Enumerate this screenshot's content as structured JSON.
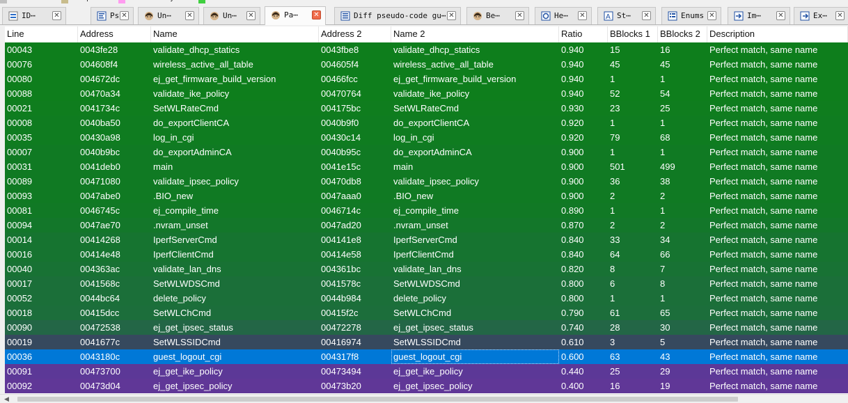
{
  "legend": [
    {
      "label": "ction",
      "color": ""
    },
    {
      "label": "Data",
      "color": "#c0c0c0"
    },
    {
      "label": "Unexplored",
      "color": "#c8bc8c"
    },
    {
      "label": "External symbol",
      "color": "#ff9cf0"
    },
    {
      "label": "Lumina function",
      "color": "#40d040"
    }
  ],
  "tabs": [
    {
      "label": "ID⋯",
      "icon": "ida-view-icon"
    },
    {
      "label": "Ps⋯",
      "icon": "pseudocode-icon"
    },
    {
      "label": "Un⋯",
      "icon": "unmatched-person-icon"
    },
    {
      "label": "Un⋯",
      "icon": "unmatched-person-icon"
    },
    {
      "label": "Pa⋯",
      "icon": "partial-person-icon",
      "active": true
    },
    {
      "label": "Diff pseudo-code gu⋯",
      "icon": "diff-document-icon"
    },
    {
      "label": "Be⋯",
      "icon": "best-person-icon"
    },
    {
      "label": "He⋯",
      "icon": "hex-view-icon"
    },
    {
      "label": "St⋯",
      "icon": "strings-icon"
    },
    {
      "label": "Enums",
      "icon": "enums-icon"
    },
    {
      "label": "Im⋯",
      "icon": "imports-icon"
    },
    {
      "label": "Ex⋯",
      "icon": "exports-icon"
    }
  ],
  "columns": [
    "Line",
    "Address",
    "Name",
    "Address 2",
    "Name 2",
    "Ratio",
    "BBlocks 1",
    "BBlocks 2",
    "Description"
  ],
  "rows": [
    {
      "line": "00043",
      "addr": "0043fe28",
      "name": "validate_dhcp_statics",
      "addr2": "0043fbe8",
      "name2": "validate_dhcp_statics",
      "ratio": "0.940",
      "bb1": "15",
      "bb2": "16",
      "desc": "Perfect match, same name",
      "bg": "#0e7e1c"
    },
    {
      "line": "00076",
      "addr": "004608f4",
      "name": "wireless_active_all_table",
      "addr2": "004605f4",
      "name2": "wireless_active_all_table",
      "ratio": "0.940",
      "bb1": "45",
      "bb2": "45",
      "desc": "Perfect match, same name",
      "bg": "#0e7e1c"
    },
    {
      "line": "00080",
      "addr": "004672dc",
      "name": "ej_get_firmware_build_version",
      "addr2": "00466fcc",
      "name2": "ej_get_firmware_build_version",
      "ratio": "0.940",
      "bb1": "1",
      "bb2": "1",
      "desc": "Perfect match, same name",
      "bg": "#0e7e1c"
    },
    {
      "line": "00088",
      "addr": "00470a34",
      "name": "validate_ike_policy",
      "addr2": "00470764",
      "name2": "validate_ike_policy",
      "ratio": "0.940",
      "bb1": "52",
      "bb2": "54",
      "desc": "Perfect match, same name",
      "bg": "#0e7e1c"
    },
    {
      "line": "00021",
      "addr": "0041734c",
      "name": "SetWLRateCmd",
      "addr2": "004175bc",
      "name2": "SetWLRateCmd",
      "ratio": "0.930",
      "bb1": "23",
      "bb2": "25",
      "desc": "Perfect match, same name",
      "bg": "#0f7d1e"
    },
    {
      "line": "00008",
      "addr": "0040ba50",
      "name": "do_exportClientCA",
      "addr2": "0040b9f0",
      "name2": "do_exportClientCA",
      "ratio": "0.920",
      "bb1": "1",
      "bb2": "1",
      "desc": "Perfect match, same name",
      "bg": "#0f7c20"
    },
    {
      "line": "00035",
      "addr": "00430a98",
      "name": "log_in_cgi",
      "addr2": "00430c14",
      "name2": "log_in_cgi",
      "ratio": "0.920",
      "bb1": "79",
      "bb2": "68",
      "desc": "Perfect match, same name",
      "bg": "#0f7c20"
    },
    {
      "line": "00007",
      "addr": "0040b9bc",
      "name": "do_exportAdminCA",
      "addr2": "0040b95c",
      "name2": "do_exportAdminCA",
      "ratio": "0.900",
      "bb1": "1",
      "bb2": "1",
      "desc": "Perfect match, same name",
      "bg": "#107a23"
    },
    {
      "line": "00031",
      "addr": "0041deb0",
      "name": "main",
      "addr2": "0041e15c",
      "name2": "main",
      "ratio": "0.900",
      "bb1": "501",
      "bb2": "499",
      "desc": "Perfect match, same name",
      "bg": "#107a23"
    },
    {
      "line": "00089",
      "addr": "00471080",
      "name": "validate_ipsec_policy",
      "addr2": "00470db8",
      "name2": "validate_ipsec_policy",
      "ratio": "0.900",
      "bb1": "36",
      "bb2": "38",
      "desc": "Perfect match, same name",
      "bg": "#107a23"
    },
    {
      "line": "00093",
      "addr": "0047abe0",
      "name": ".BIO_new",
      "addr2": "0047aaa0",
      "name2": ".BIO_new",
      "ratio": "0.900",
      "bb1": "2",
      "bb2": "2",
      "desc": "Perfect match, same name",
      "bg": "#107a23"
    },
    {
      "line": "00081",
      "addr": "0046745c",
      "name": "ej_compile_time",
      "addr2": "0046714c",
      "name2": "ej_compile_time",
      "ratio": "0.890",
      "bb1": "1",
      "bb2": "1",
      "desc": "Perfect match, same name",
      "bg": "#117925"
    },
    {
      "line": "00094",
      "addr": "0047ae70",
      "name": ".nvram_unset",
      "addr2": "0047ad20",
      "name2": ".nvram_unset",
      "ratio": "0.870",
      "bb1": "2",
      "bb2": "2",
      "desc": "Perfect match, same name",
      "bg": "#13772a"
    },
    {
      "line": "00014",
      "addr": "00414268",
      "name": "IperfServerCmd",
      "addr2": "004141e8",
      "name2": "IperfServerCmd",
      "ratio": "0.840",
      "bb1": "33",
      "bb2": "34",
      "desc": "Perfect match, same name",
      "bg": "#167430"
    },
    {
      "line": "00016",
      "addr": "00414e48",
      "name": "IperfClientCmd",
      "addr2": "00414e58",
      "name2": "IperfClientCmd",
      "ratio": "0.840",
      "bb1": "64",
      "bb2": "66",
      "desc": "Perfect match, same name",
      "bg": "#167430"
    },
    {
      "line": "00040",
      "addr": "004363ac",
      "name": "validate_lan_dns",
      "addr2": "004361bc",
      "name2": "validate_lan_dns",
      "ratio": "0.820",
      "bb1": "8",
      "bb2": "7",
      "desc": "Perfect match, same name",
      "bg": "#187234"
    },
    {
      "line": "00017",
      "addr": "0041568c",
      "name": "SetWLWDSCmd",
      "addr2": "0041578c",
      "name2": "SetWLWDSCmd",
      "ratio": "0.800",
      "bb1": "6",
      "bb2": "8",
      "desc": "Perfect match, same name",
      "bg": "#1b6f39"
    },
    {
      "line": "00052",
      "addr": "0044bc64",
      "name": "delete_policy",
      "addr2": "0044b984",
      "name2": "delete_policy",
      "ratio": "0.800",
      "bb1": "1",
      "bb2": "1",
      "desc": "Perfect match, same name",
      "bg": "#1b6f39"
    },
    {
      "line": "00018",
      "addr": "00415dcc",
      "name": "SetWLChCmd",
      "addr2": "00415f2c",
      "name2": "SetWLChCmd",
      "ratio": "0.790",
      "bb1": "61",
      "bb2": "65",
      "desc": "Perfect match, same name",
      "bg": "#1c6e3b"
    },
    {
      "line": "00090",
      "addr": "00472538",
      "name": "ej_get_ipsec_status",
      "addr2": "00472278",
      "name2": "ej_get_ipsec_status",
      "ratio": "0.740",
      "bb1": "28",
      "bb2": "30",
      "desc": "Perfect match, same name",
      "bg": "#236646"
    },
    {
      "line": "00019",
      "addr": "0041677c",
      "name": "SetWLSSIDCmd",
      "addr2": "00416974",
      "name2": "SetWLSSIDCmd",
      "ratio": "0.610",
      "bb1": "3",
      "bb2": "5",
      "desc": "Perfect match, same name",
      "bg": "#36495e"
    },
    {
      "line": "00036",
      "addr": "0043180c",
      "name": "guest_logout_cgi",
      "addr2": "004317f8",
      "name2": "guest_logout_cgi",
      "ratio": "0.600",
      "bb1": "63",
      "bb2": "43",
      "desc": "Perfect match, same name",
      "bg": "#0078d7",
      "selected": true
    },
    {
      "line": "00091",
      "addr": "00473700",
      "name": "ej_get_ike_policy",
      "addr2": "00473494",
      "name2": "ej_get_ike_policy",
      "ratio": "0.440",
      "bb1": "25",
      "bb2": "29",
      "desc": "Perfect match, same name",
      "bg": "#5c3897"
    },
    {
      "line": "00092",
      "addr": "00473d04",
      "name": "ej_get_ipsec_policy",
      "addr2": "00473b20",
      "name2": "ej_get_ipsec_policy",
      "ratio": "0.400",
      "bb1": "16",
      "bb2": "19",
      "desc": "Perfect match, same name",
      "bg": "#603797"
    }
  ]
}
